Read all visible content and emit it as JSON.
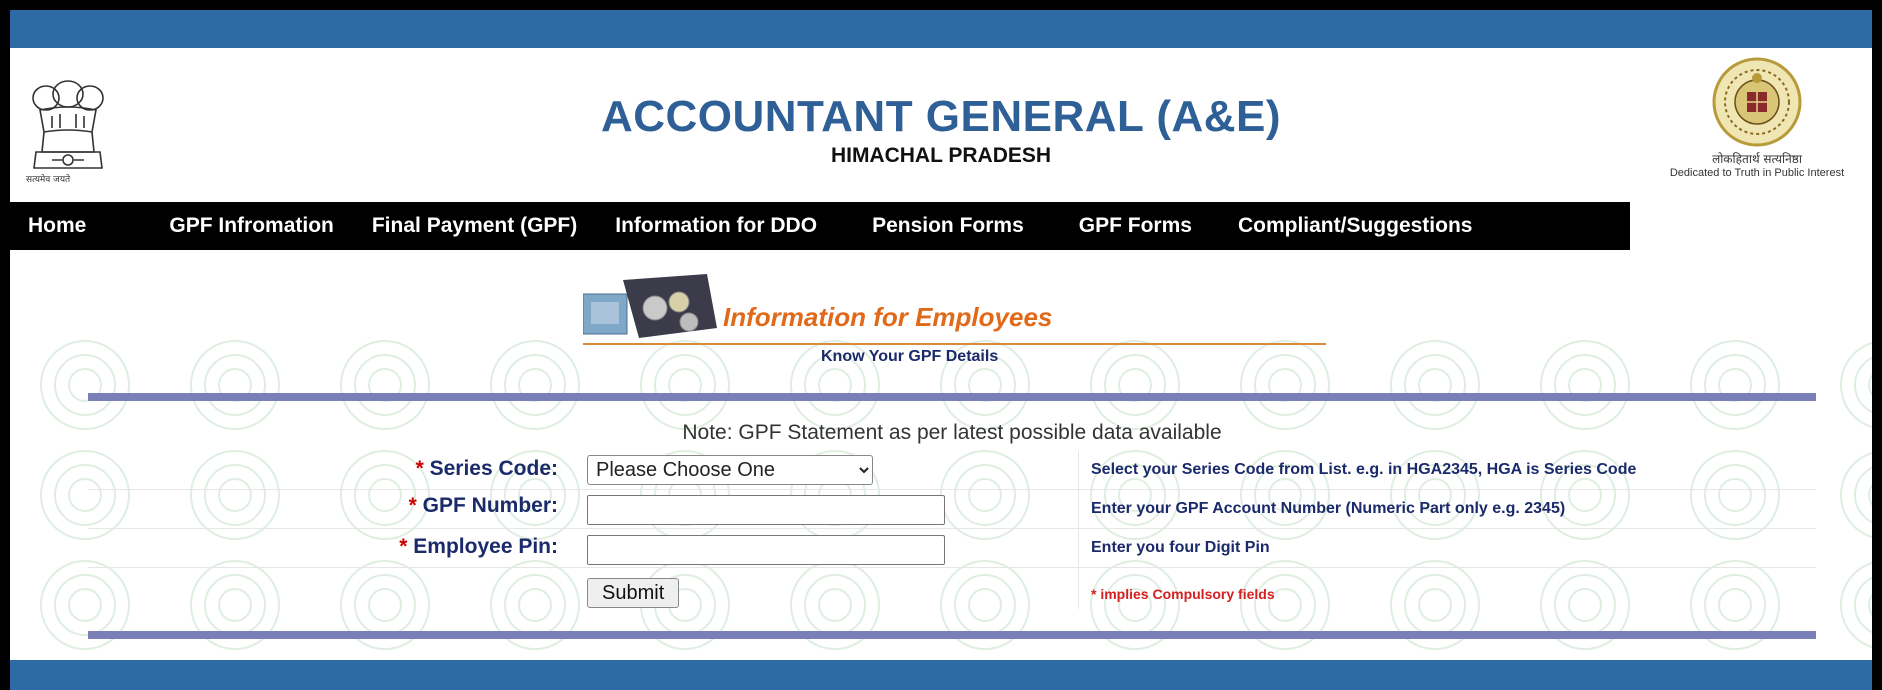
{
  "header": {
    "title": "ACCOUNTANT GENERAL (A&E)",
    "subtitle": "HIMACHAL PRADESH",
    "left_emblem_caption": "सत्यमेव जयते",
    "right_emblem_caption_hindi": "लोकहितार्थ सत्यनिष्ठा",
    "right_emblem_caption_english": "Dedicated to Truth in Public Interest"
  },
  "nav": {
    "items": [
      {
        "label": "Home"
      },
      {
        "label": "GPF Infromation"
      },
      {
        "label": "Final Payment (GPF)"
      },
      {
        "label": "Information for DDO"
      },
      {
        "label": "Pension Forms"
      },
      {
        "label": "GPF Forms"
      },
      {
        "label": "Compliant/Suggestions"
      }
    ]
  },
  "banner": {
    "title": "Information for Employees",
    "subtitle": "Know Your GPF Details"
  },
  "form": {
    "note": "Note: GPF Statement as per latest possible data available",
    "required_marker": "*",
    "series_code": {
      "label": "Series Code:",
      "selected": "Please Choose One",
      "help": "Select your Series Code from List. e.g. in HGA2345, HGA is Series Code"
    },
    "gpf_number": {
      "label": "GPF Number:",
      "value": "",
      "help": "Enter your GPF Account Number (Numeric Part only e.g. 2345)"
    },
    "employee_pin": {
      "label": "Employee Pin:",
      "value": "",
      "help": "Enter you four Digit Pin"
    },
    "submit_label": "Submit",
    "compulsory_note": "* implies Compulsory fields"
  },
  "colors": {
    "top_bar": "#2e6aa4",
    "title": "#2e5f97",
    "nav_bg": "#000000",
    "panel_bar": "#7b7fb8",
    "label": "#1a2a6a",
    "required": "#cc0000",
    "banner_title": "#e06a1a"
  }
}
